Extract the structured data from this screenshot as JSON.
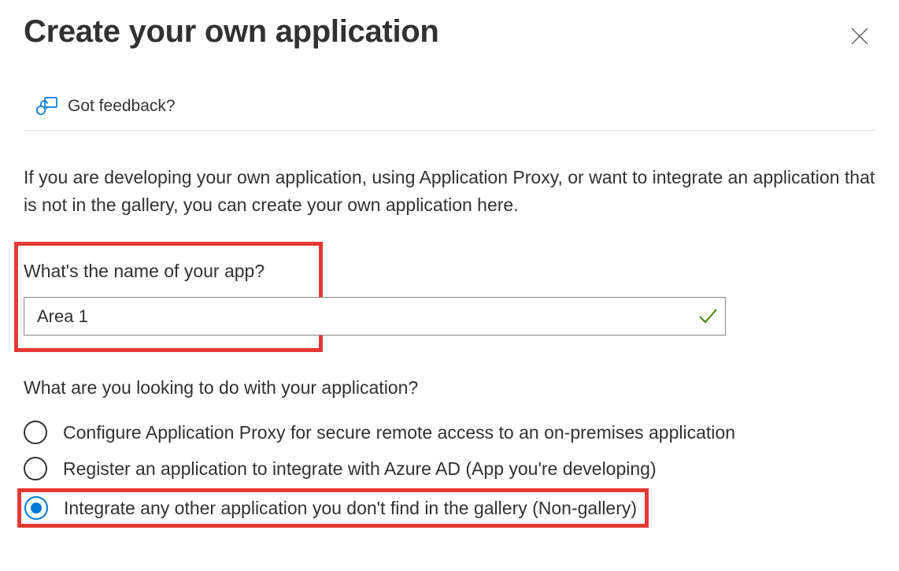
{
  "header": {
    "title": "Create your own application"
  },
  "feedback": {
    "label": "Got feedback?"
  },
  "description": "If you are developing your own application, using Application Proxy, or want to integrate an application that is not in the gallery, you can create your own application here.",
  "nameField": {
    "label": "What's the name of your app?",
    "value": "Area 1"
  },
  "purpose": {
    "label": "What are you looking to do with your application?",
    "options": [
      {
        "label": "Configure Application Proxy for secure remote access to an on-premises application",
        "selected": false
      },
      {
        "label": "Register an application to integrate with Azure AD (App you're developing)",
        "selected": false
      },
      {
        "label": "Integrate any other application you don't find in the gallery (Non-gallery)",
        "selected": true
      }
    ]
  },
  "colors": {
    "accent": "#0078d4",
    "highlight": "#e53935",
    "success": "#498205"
  }
}
